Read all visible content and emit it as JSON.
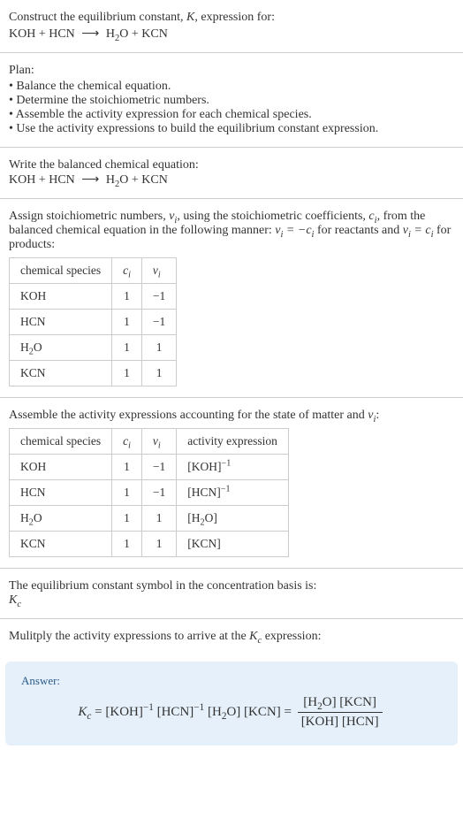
{
  "question": {
    "line1_a": "Construct the equilibrium constant, ",
    "line1_k": "K",
    "line1_b": ", expression for:",
    "equation": "KOH + HCN  ⟶  H₂O + KCN"
  },
  "plan": {
    "title": "Plan:",
    "items": [
      "• Balance the chemical equation.",
      "• Determine the stoichiometric numbers.",
      "• Assemble the activity expression for each chemical species.",
      "• Use the activity expressions to build the equilibrium constant expression."
    ]
  },
  "balanced": {
    "title": "Write the balanced chemical equation:",
    "equation": "KOH + HCN  ⟶  H₂O + KCN"
  },
  "stoich": {
    "text_a": "Assign stoichiometric numbers, ",
    "nu_i": "ν",
    "sub_i": "i",
    "text_b": ", using the stoichiometric coefficients, ",
    "c_i": "c",
    "text_c": ", from the balanced chemical equation in the following manner: ",
    "rule1_a": "ν",
    "rule1_b": " = −",
    "rule1_c": "c",
    "text_d": " for reactants and ",
    "rule2_a": "ν",
    "rule2_b": " = ",
    "rule2_c": "c",
    "text_e": " for products:",
    "headers": {
      "species": "chemical species",
      "ci": "c",
      "nui": "ν"
    },
    "rows": [
      {
        "species": "KOH",
        "ci": "1",
        "nui": "−1"
      },
      {
        "species": "HCN",
        "ci": "1",
        "nui": "−1"
      },
      {
        "species": "H₂O",
        "ci": "1",
        "nui": "1"
      },
      {
        "species": "KCN",
        "ci": "1",
        "nui": "1"
      }
    ]
  },
  "activity": {
    "title_a": "Assemble the activity expressions accounting for the state of matter and ",
    "nu": "ν",
    "sub_i": "i",
    "title_b": ":",
    "headers": {
      "species": "chemical species",
      "ci": "c",
      "nui": "ν",
      "act": "activity expression"
    },
    "rows": [
      {
        "species": "KOH",
        "ci": "1",
        "nui": "−1",
        "base": "[KOH]",
        "exp": "−1"
      },
      {
        "species": "HCN",
        "ci": "1",
        "nui": "−1",
        "base": "[HCN]",
        "exp": "−1"
      },
      {
        "species": "H₂O",
        "ci": "1",
        "nui": "1",
        "base": "[H₂O]",
        "exp": ""
      },
      {
        "species": "KCN",
        "ci": "1",
        "nui": "1",
        "base": "[KCN]",
        "exp": ""
      }
    ]
  },
  "basis": {
    "line1": "The equilibrium constant symbol in the concentration basis is:",
    "symbol": "K",
    "sub": "c"
  },
  "multiply": {
    "text_a": "Mulitply the activity expressions to arrive at the ",
    "symbol": "K",
    "sub": "c",
    "text_b": " expression:"
  },
  "answer": {
    "label": "Answer:",
    "lhs_k": "K",
    "lhs_sub": "c",
    "eq": " = ",
    "t1_base": "[KOH]",
    "t1_exp": "−1",
    "t2_base": "[HCN]",
    "t2_exp": "−1",
    "t3": "[H₂O]",
    "t4": "[KCN]",
    "eq2": " = ",
    "num": "[H₂O] [KCN]",
    "den": "[KOH] [HCN]"
  },
  "chart_data": {
    "type": "table",
    "tables": [
      {
        "title": "Stoichiometric numbers",
        "columns": [
          "chemical species",
          "c_i",
          "ν_i"
        ],
        "rows": [
          [
            "KOH",
            1,
            -1
          ],
          [
            "HCN",
            1,
            -1
          ],
          [
            "H2O",
            1,
            1
          ],
          [
            "KCN",
            1,
            1
          ]
        ]
      },
      {
        "title": "Activity expressions",
        "columns": [
          "chemical species",
          "c_i",
          "ν_i",
          "activity expression"
        ],
        "rows": [
          [
            "KOH",
            1,
            -1,
            "[KOH]^(-1)"
          ],
          [
            "HCN",
            1,
            -1,
            "[HCN]^(-1)"
          ],
          [
            "H2O",
            1,
            1,
            "[H2O]"
          ],
          [
            "KCN",
            1,
            1,
            "[KCN]"
          ]
        ]
      }
    ]
  }
}
